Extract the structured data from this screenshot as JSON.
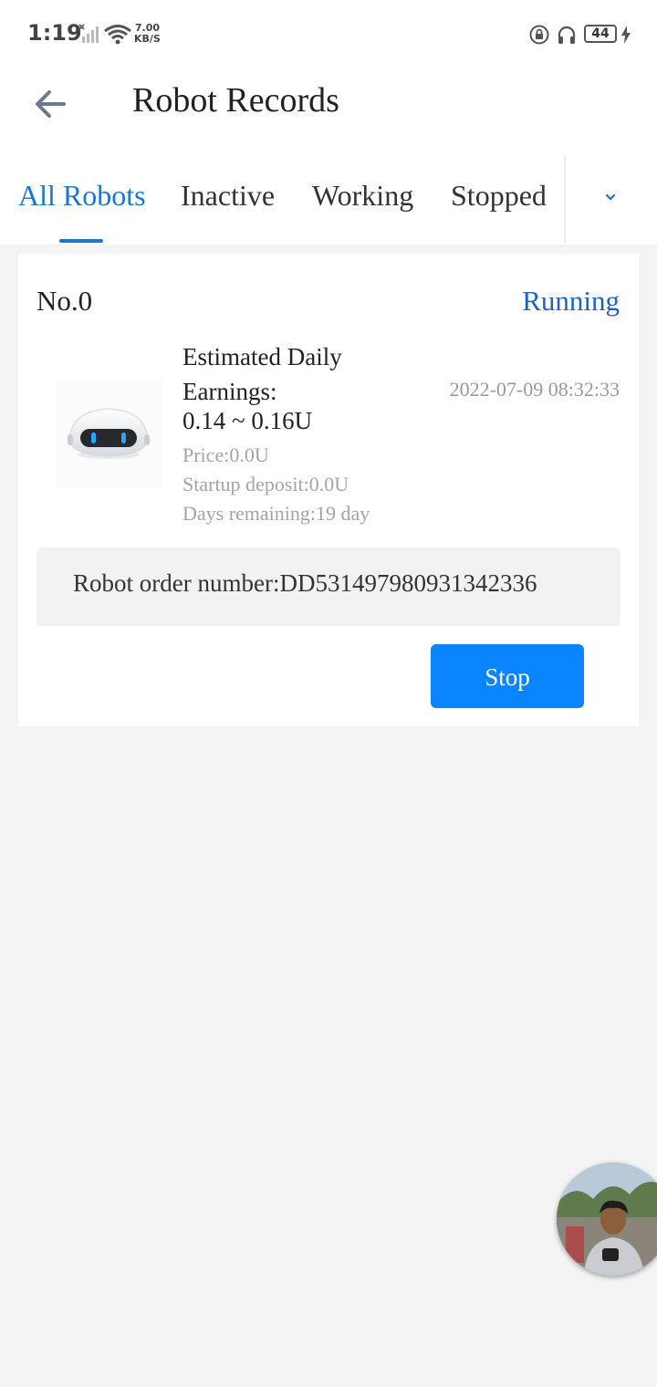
{
  "status_bar": {
    "time": "1:19",
    "net_speed_value": "7.00",
    "net_speed_unit": "KB/S",
    "battery": "44",
    "icons": [
      "signal-icon",
      "wifi-icon",
      "lock-rotation-icon",
      "headphone-icon",
      "battery-icon",
      "charging-bolt-icon"
    ]
  },
  "header": {
    "title": "Robot Records",
    "back_icon": "arrow-left-icon"
  },
  "tabs": {
    "items": [
      {
        "label": "All Robots",
        "active": true
      },
      {
        "label": "Inactive",
        "active": false
      },
      {
        "label": "Working",
        "active": false
      },
      {
        "label": "Stopped",
        "active": false
      }
    ],
    "more_icon": "chevron-down-icon"
  },
  "record": {
    "number": "No.0",
    "status": "Running",
    "earnings_label": "Estimated Daily Earnings:",
    "earnings_value": "0.14 ~ 0.16U",
    "datetime": "2022-07-09 08:32:33",
    "price": "Price:0.0U",
    "startup_deposit": "Startup deposit:0.0U",
    "days_remaining": "Days remaining:19 day",
    "order_number": "Robot order number:DD531497980931342336",
    "stop_label": "Stop"
  },
  "colors": {
    "accent": "#1976d2",
    "status_running": "#1e63c6",
    "button": "#0a84ff",
    "background": "#f4f4f4"
  }
}
